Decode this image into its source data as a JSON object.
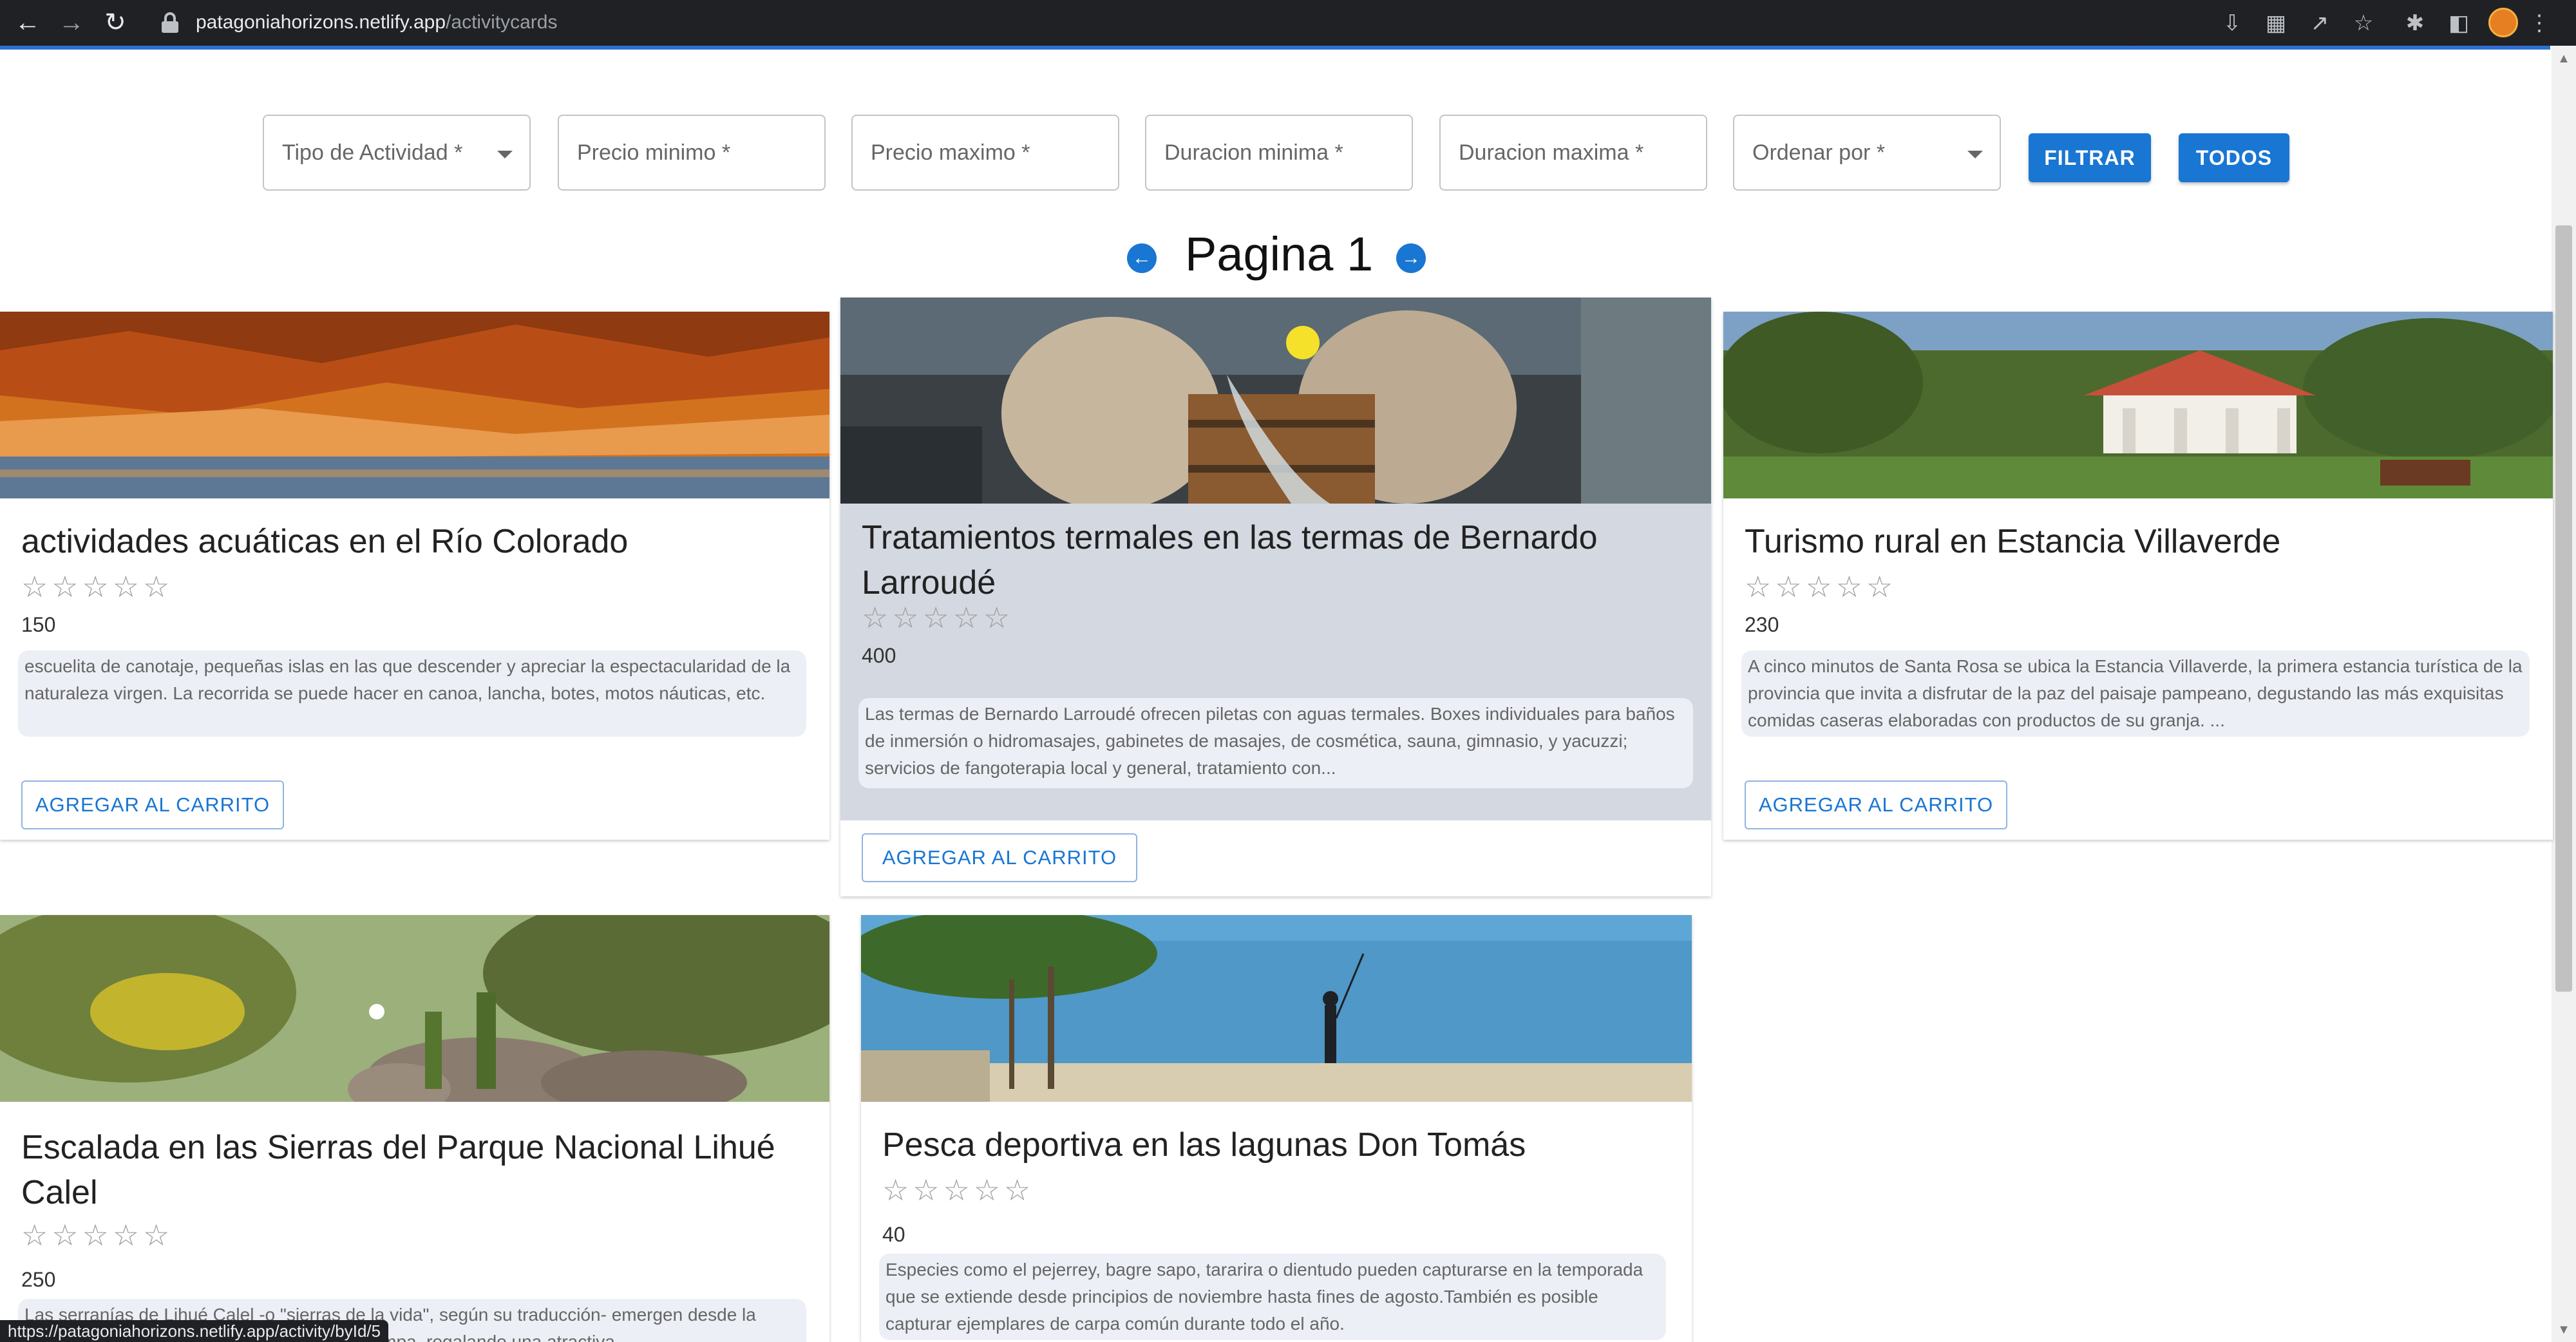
{
  "browser": {
    "url_host": "patagoniahorizons.netlify.app",
    "url_path": "/activitycards",
    "status_url": "https://patagoniahorizons.netlify.app/activity/byId/5"
  },
  "filters": {
    "tipo": "Tipo de Actividad *",
    "precio_min": "Precio minimo *",
    "precio_max": "Precio maximo *",
    "duracion_min": "Duracion minima *",
    "duracion_max": "Duracion maxima *",
    "ordenar": "Ordenar por *",
    "filtrar_label": "FILTRAR",
    "todos_label": "TODOS"
  },
  "pagination": {
    "label": "Pagina 1"
  },
  "cards": [
    {
      "title": "actividades acuáticas en el Río Colorado",
      "stars": "☆☆☆☆☆",
      "price": "150",
      "description": "escuelita de canotaje, pequeñas islas en las que descender y apreciar la espectacularidad de la naturaleza virgen. La recorrida se puede hacer en canoa, lancha, botes, motos náuticas, etc.",
      "button": "AGREGAR AL CARRITO"
    },
    {
      "title": "Tratamientos termales en las termas de Bernardo Larroudé",
      "stars": "☆☆☆☆☆",
      "price": "400",
      "description": "Las termas de Bernardo Larroudé ofrecen piletas con aguas termales. Boxes individuales para baños de inmersión o hidromasajes, gabinetes de masajes, de cosmética, sauna, gimnasio, y yacuzzi; servicios de fangoterapia local y general, tratamiento con...",
      "button": "AGREGAR AL CARRITO"
    },
    {
      "title": "Turismo rural en Estancia Villaverde",
      "stars": "☆☆☆☆☆",
      "price": "230",
      "description": "A cinco minutos de Santa Rosa se ubica la Estancia Villaverde, la primera estancia turística de la provincia que invita a disfrutar de la paz del paisaje pampeano, degustando las más exquisitas comidas caseras elaboradas con productos de su granja. ...",
      "button": "AGREGAR AL CARRITO"
    },
    {
      "title": "Escalada en las Sierras del Parque Nacional Lihué Calel",
      "stars": "☆☆☆☆☆",
      "price": "250",
      "description": "Las serranías de Lihué Calel -o \"sierras de la vida\", según su traducción- emergen desde la llanura pampeana, en el centro-sur de La Pampa, regalando una atractiva..."
    },
    {
      "title": "Pesca deportiva en las lagunas Don Tomás",
      "stars": "☆☆☆☆☆",
      "price": "40",
      "description": "Especies como el pejerrey, bagre sapo, tararira o dientudo pueden capturarse en la temporada que se extiende desde principios de noviembre hasta fines de agosto.También es posible capturar ejemplares de carpa común durante todo el año."
    }
  ]
}
